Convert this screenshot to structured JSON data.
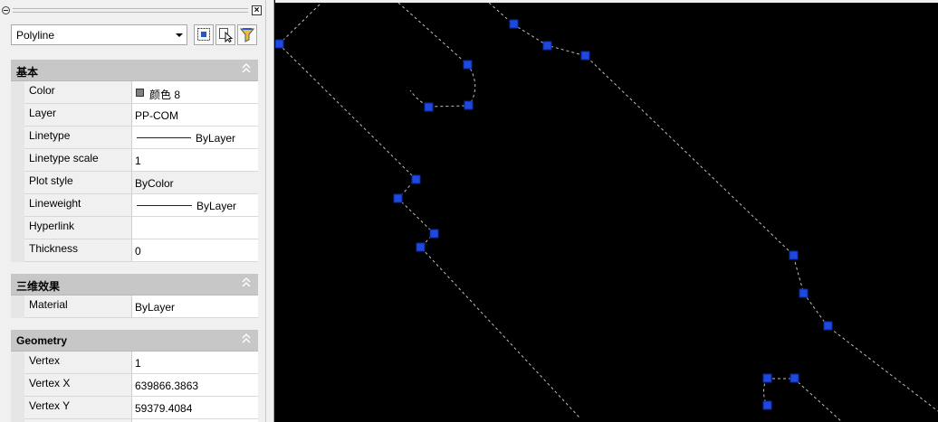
{
  "panel": {
    "object_type": "Polyline",
    "sections": [
      {
        "title": "基本",
        "rows": [
          {
            "name": "Color",
            "value": "颜色 8",
            "kind": "color",
            "swatch": "#808080"
          },
          {
            "name": "Layer",
            "value": "PP-COM",
            "kind": "text"
          },
          {
            "name": "Linetype",
            "value": "ByLayer",
            "kind": "line"
          },
          {
            "name": "Linetype scale",
            "value": "1",
            "kind": "text"
          },
          {
            "name": "Plot style",
            "value": "ByColor",
            "kind": "grey"
          },
          {
            "name": "Lineweight",
            "value": "ByLayer",
            "kind": "line"
          },
          {
            "name": "Hyperlink",
            "value": "",
            "kind": "text"
          },
          {
            "name": "Thickness",
            "value": "0",
            "kind": "text"
          }
        ]
      },
      {
        "title": "三维效果",
        "rows": [
          {
            "name": "Material",
            "value": "ByLayer",
            "kind": "text"
          }
        ]
      },
      {
        "title": "Geometry",
        "rows": [
          {
            "name": "Vertex",
            "value": "1",
            "kind": "text"
          },
          {
            "name": "Vertex X",
            "value": "639866.3863",
            "kind": "text"
          },
          {
            "name": "Vertex Y",
            "value": "59379.4084",
            "kind": "text"
          }
        ]
      }
    ]
  },
  "colors": {
    "canvas_background": "#000000",
    "grip": "#1f48e0",
    "polyline": "#bfbfbf"
  }
}
